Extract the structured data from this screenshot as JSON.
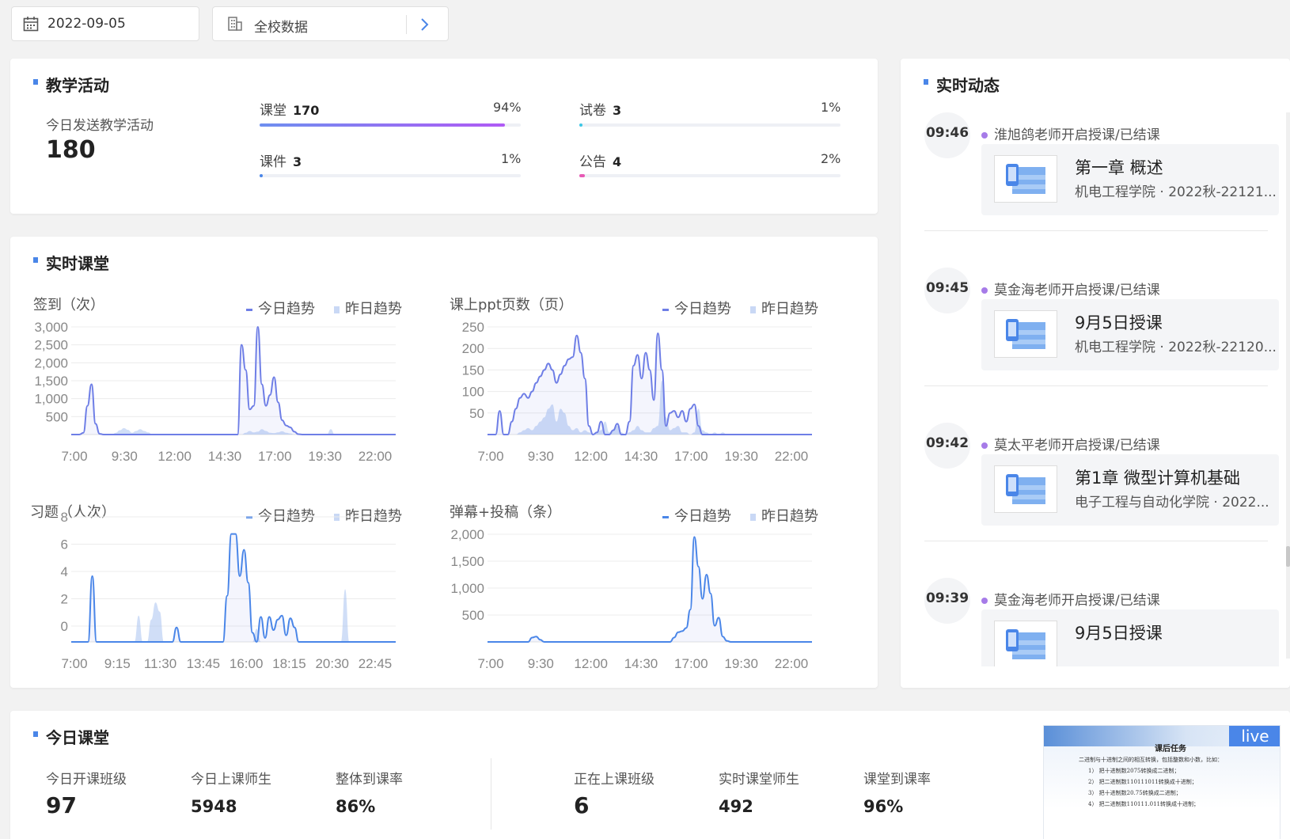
{
  "topbar": {
    "date": "2022-09-05",
    "scope": "全校数据"
  },
  "teaching_activity": {
    "title": "教学活动",
    "today_label": "今日发送教学活动",
    "today_total": "180",
    "items": [
      {
        "name": "课堂",
        "count": "170",
        "pct": "94%",
        "ratio": 0.94,
        "color": "#7b6cf6"
      },
      {
        "name": "试卷",
        "count": "3",
        "pct": "1%",
        "ratio": 0.01,
        "color": "#3cc7e6"
      },
      {
        "name": "课件",
        "count": "3",
        "pct": "1%",
        "ratio": 0.01,
        "color": "#4a86e8"
      },
      {
        "name": "公告",
        "count": "4",
        "pct": "2%",
        "ratio": 0.02,
        "color": "#e75ab5"
      }
    ]
  },
  "live_class": {
    "title": "实时课堂",
    "legend_today": "今日趋势",
    "legend_yesterday": "昨日趋势"
  },
  "chart_data": [
    {
      "type": "area",
      "title": "签到（次）",
      "y_ticks": [
        "3,000",
        "2,500",
        "2,000",
        "1,500",
        "1,000",
        "500"
      ],
      "x_ticks": [
        "7:00",
        "9:30",
        "12:00",
        "14:30",
        "17:00",
        "19:30",
        "22:00"
      ],
      "ylim": [
        0,
        3000
      ],
      "series": [
        {
          "name": "今日趋势",
          "values": [
            0,
            0,
            0,
            50,
            800,
            1400,
            300,
            20,
            0,
            0,
            0,
            0,
            0,
            0,
            0,
            0,
            0,
            0,
            0,
            0,
            0,
            0,
            0,
            0,
            0,
            0,
            0,
            0,
            0,
            0,
            0,
            0,
            0,
            0,
            0,
            0,
            0,
            0,
            0,
            0,
            0,
            0,
            2500,
            1800,
            700,
            800,
            3000,
            1400,
            800,
            1100,
            1600,
            900,
            400,
            250,
            200,
            80,
            10,
            0,
            0,
            0,
            0,
            0,
            0,
            0,
            0,
            0,
            0,
            0,
            0,
            0,
            0,
            0,
            0,
            0,
            0,
            0,
            0,
            0,
            0,
            0,
            0
          ]
        },
        {
          "name": "昨日趋势",
          "values": [
            0,
            0,
            0,
            0,
            0,
            0,
            0,
            0,
            0,
            0,
            0,
            50,
            120,
            180,
            130,
            50,
            100,
            150,
            100,
            60,
            0,
            0,
            0,
            0,
            0,
            0,
            0,
            0,
            0,
            0,
            0,
            0,
            0,
            0,
            0,
            0,
            0,
            0,
            0,
            0,
            0,
            0,
            0,
            50,
            100,
            60,
            80,
            150,
            100,
            50,
            40,
            60,
            90,
            50,
            30,
            0,
            0,
            0,
            0,
            0,
            0,
            0,
            0,
            0,
            150,
            0,
            0,
            0,
            0,
            0,
            0,
            0,
            0,
            0,
            0,
            0,
            0,
            0,
            0,
            0,
            0
          ]
        }
      ]
    },
    {
      "type": "area",
      "title": "课上ppt页数（页）",
      "y_ticks": [
        "250",
        "200",
        "150",
        "100",
        "50"
      ],
      "x_ticks": [
        "7:00",
        "9:30",
        "12:00",
        "14:30",
        "17:00",
        "19:30",
        "22:00"
      ],
      "ylim": [
        0,
        250
      ],
      "series": [
        {
          "name": "今日趋势",
          "values": [
            0,
            0,
            0,
            55,
            0,
            0,
            30,
            60,
            85,
            95,
            85,
            100,
            120,
            135,
            150,
            165,
            150,
            120,
            140,
            160,
            175,
            180,
            230,
            190,
            130,
            20,
            0,
            5,
            30,
            0,
            0,
            10,
            25,
            0,
            0,
            30,
            160,
            185,
            130,
            190,
            150,
            80,
            235,
            150,
            20,
            50,
            55,
            40,
            55,
            30,
            60,
            70,
            20,
            0,
            0,
            0,
            0,
            0,
            0,
            0,
            0,
            0,
            0,
            0,
            0,
            0,
            0,
            0,
            0,
            0,
            0,
            0,
            0,
            0,
            0,
            0,
            0,
            0,
            0,
            0,
            0
          ]
        },
        {
          "name": "昨日趋势",
          "values": [
            0,
            0,
            0,
            0,
            0,
            0,
            0,
            0,
            5,
            10,
            15,
            10,
            20,
            30,
            40,
            60,
            70,
            30,
            60,
            50,
            20,
            10,
            15,
            5,
            10,
            5,
            0,
            5,
            10,
            30,
            5,
            10,
            20,
            5,
            0,
            5,
            10,
            20,
            10,
            5,
            5,
            15,
            20,
            125,
            40,
            10,
            15,
            20,
            5,
            5,
            0,
            5,
            60,
            10,
            5,
            0,
            5,
            0,
            5,
            0,
            0,
            0,
            0,
            0,
            0,
            0,
            0,
            0,
            0,
            0,
            0,
            0,
            0,
            0,
            0,
            0,
            0,
            0,
            0,
            0,
            0
          ]
        }
      ]
    },
    {
      "type": "area",
      "title": "习题（人次）",
      "y_ticks": [
        "8",
        "6",
        "4",
        "2",
        "0"
      ],
      "x_ticks": [
        "7:00",
        "9:15",
        "11:30",
        "13:45",
        "16:00",
        "18:15",
        "20:30",
        "22:45"
      ],
      "ylim": [
        -1.5,
        8
      ],
      "series": [
        {
          "name": "今日趋势",
          "values": [
            -1.5,
            -1.5,
            -1.5,
            -1.5,
            -1.5,
            3.5,
            -1.5,
            -1.5,
            -1.5,
            -1.5,
            -1.5,
            -1.5,
            -1.5,
            -1.5,
            -1.5,
            -1.5,
            -1.5,
            -1.5,
            -1.5,
            -1.5,
            -1.5,
            -1.5,
            -1.5,
            -1.5,
            -1.5,
            -0.4,
            -1.5,
            -1.5,
            -1.5,
            -1.5,
            -1.5,
            -1.5,
            -1.5,
            -1.5,
            -1.5,
            -1.5,
            -1.5,
            2,
            6.7,
            6.7,
            3.5,
            5.5,
            3,
            -0.8,
            -1.5,
            0.4,
            -1.2,
            0.4,
            -0.6,
            0.2,
            0.5,
            -1,
            0.3,
            -0.4,
            -1.5,
            -1.5,
            -1.5,
            -1.5,
            -1.5,
            -1.5,
            -1.5,
            -1.5,
            -1.5,
            -1.5,
            -1.5,
            -1.5,
            -1.5,
            -1.5,
            -1.5,
            -1.5,
            -1.5,
            -1.5,
            -1.5,
            -1.5,
            -1.5,
            -1.5,
            -1.5,
            -1.5
          ]
        },
        {
          "name": "昨日趋势",
          "values": [
            -1.5,
            -1.5,
            -1.5,
            -1.5,
            -1.5,
            -1.5,
            -1.5,
            -1.5,
            -1.5,
            -1.5,
            -1.5,
            -1.5,
            -1.5,
            -1.5,
            -1.5,
            -1.5,
            0.5,
            -1.5,
            -1.5,
            0.2,
            1.5,
            0.8,
            -1.5,
            -1.5,
            -1.5,
            -1.5,
            -1.5,
            -1.5,
            -1.5,
            -1.5,
            -1.5,
            -1.5,
            -1.5,
            -1.5,
            -1.5,
            -1.5,
            -1.5,
            -1.5,
            -1.5,
            -1.5,
            -1.5,
            -1.5,
            -1.5,
            -1.5,
            -0.5,
            -1.5,
            -1.5,
            -1.5,
            -1.5,
            -1.5,
            -1.5,
            -1.5,
            -1.5,
            -1.5,
            -1.5,
            -1.5,
            -1.5,
            -1.5,
            -1.5,
            -1.5,
            -1.5,
            -1.5,
            -1.5,
            -1.5,
            -1.5,
            2.5,
            -1.5,
            -1.5,
            -1.5,
            -1.5,
            -1.5,
            -1.5,
            -1.5,
            -1.5,
            -1.5,
            -1.5,
            -1.5,
            -1.5
          ]
        }
      ]
    },
    {
      "type": "area",
      "title": "弹幕+投稿（条）",
      "y_ticks": [
        "2,000",
        "1,500",
        "1,000",
        "500"
      ],
      "x_ticks": [
        "7:00",
        "9:30",
        "12:00",
        "14:30",
        "17:00",
        "19:30",
        "22:00"
      ],
      "ylim": [
        0,
        2000
      ],
      "series": [
        {
          "name": "今日趋势",
          "values": [
            0,
            0,
            0,
            0,
            0,
            0,
            0,
            0,
            0,
            0,
            0,
            80,
            100,
            40,
            0,
            0,
            0,
            0,
            0,
            0,
            0,
            0,
            0,
            0,
            0,
            0,
            0,
            0,
            0,
            0,
            0,
            0,
            0,
            0,
            0,
            0,
            0,
            0,
            0,
            0,
            0,
            0,
            0,
            0,
            0,
            0,
            80,
            180,
            200,
            260,
            600,
            1950,
            1400,
            800,
            1250,
            900,
            300,
            450,
            100,
            20,
            0,
            0,
            0,
            0,
            0,
            0,
            0,
            0,
            0,
            0,
            0,
            0,
            0,
            0,
            0,
            0,
            0,
            0,
            0,
            0,
            0
          ]
        },
        {
          "name": "昨日趋势",
          "values": [
            0,
            0,
            0,
            0,
            0,
            0,
            0,
            0,
            0,
            0,
            0,
            0,
            0,
            0,
            0,
            0,
            0,
            0,
            0,
            0,
            0,
            0,
            0,
            0,
            0,
            0,
            0,
            0,
            0,
            0,
            0,
            0,
            0,
            0,
            0,
            0,
            0,
            0,
            0,
            0,
            0,
            0,
            0,
            0,
            0,
            0,
            0,
            0,
            0,
            0,
            0,
            0,
            0,
            0,
            0,
            0,
            0,
            0,
            0,
            0,
            0,
            0,
            0,
            0,
            0,
            0,
            0,
            0,
            0,
            0,
            0,
            0,
            0,
            0,
            0,
            0,
            0,
            0,
            0,
            0,
            0
          ]
        }
      ]
    }
  ],
  "realtime_feed": {
    "title": "实时动态",
    "items": [
      {
        "time": "09:46",
        "text": "淮旭鸽老师开启授课/已结课",
        "card_title": "第一章 概述",
        "card_sub": "机电工程学院 · 2022秋-22121..."
      },
      {
        "time": "09:45",
        "text": "莫金海老师开启授课/已结课",
        "card_title": "9月5日授课",
        "card_sub": "机电工程学院 · 2022秋-22120..."
      },
      {
        "time": "09:42",
        "text": "莫太平老师开启授课/已结课",
        "card_title": "第1章 微型计算机基础",
        "card_sub": "电子工程与自动化学院 · 2022..."
      },
      {
        "time": "09:39",
        "text": "莫金海老师开启授课/已结课",
        "card_title": "9月5日授课",
        "card_sub": ""
      }
    ]
  },
  "today_class": {
    "title": "今日课堂",
    "kpis_left": [
      {
        "label": "今日开课班级",
        "value": "97"
      },
      {
        "label": "今日上课师生",
        "value": "5948"
      },
      {
        "label": "整体到课率",
        "value": "86%"
      }
    ],
    "kpis_right": [
      {
        "label": "正在上课班级",
        "value": "6"
      },
      {
        "label": "实时课堂师生",
        "value": "492"
      },
      {
        "label": "课堂到课率",
        "value": "96%"
      }
    ],
    "live_badge": "live",
    "preview": {
      "heading": "课后任务",
      "intro": "二进制与十进制之间的相互转换，包括整数和小数，比如：",
      "lines": [
        "1） 把十进制数2075转换成二进制；",
        "2） 把二进制数110111011转换成十进制；",
        "3） 把十进制数20.75转换成二进制；",
        "4） 把二进制数110111.011转换成十进制；"
      ]
    }
  },
  "colors": {
    "accent": "#4a86e8",
    "today_line": "#6e7ee6",
    "yesterday_fill": "#c9d8f5"
  }
}
